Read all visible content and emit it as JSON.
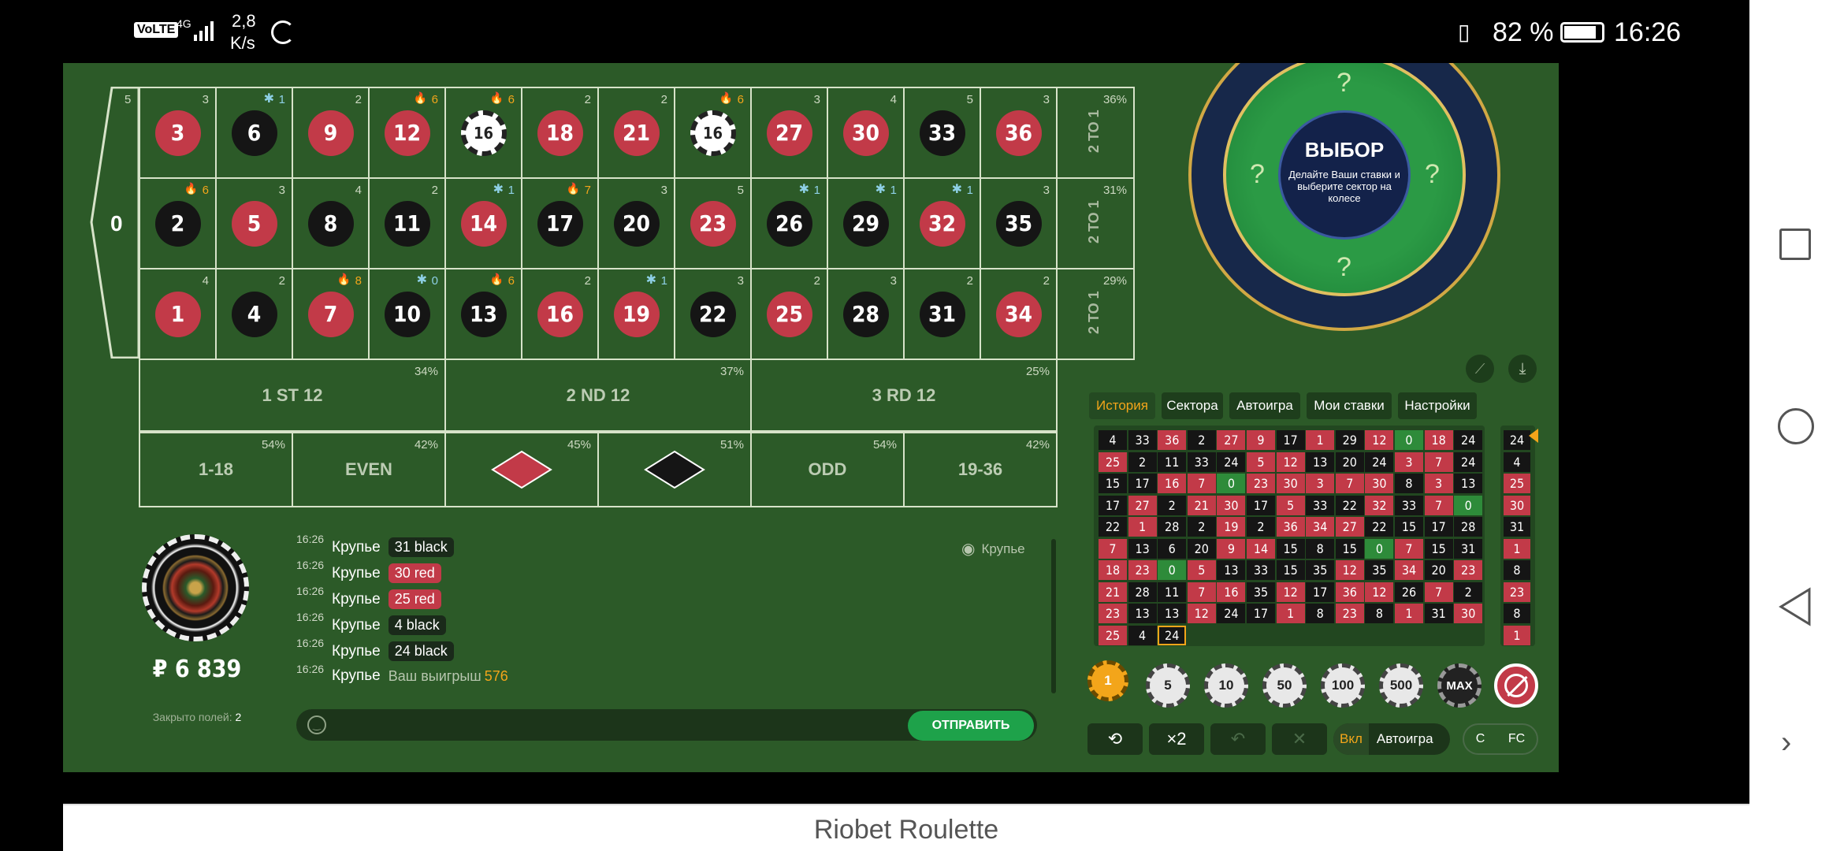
{
  "statusbar": {
    "network": "VoLTE",
    "signal": "4G",
    "speed_top": "2,8",
    "speed_bottom": "K/s",
    "battery": "82 %",
    "time": "16:26"
  },
  "app_title": "Riobet Roulette",
  "table": {
    "zero": "0",
    "zero_count": "5",
    "rows": [
      [
        {
          "n": "3",
          "c": "red",
          "cnt": "3"
        },
        {
          "n": "6",
          "c": "black",
          "cnt": "1",
          "mark": "cold"
        },
        {
          "n": "9",
          "c": "red",
          "cnt": "2"
        },
        {
          "n": "12",
          "c": "red",
          "cnt": "6",
          "mark": "hot"
        },
        {
          "n": "16",
          "c": "chip",
          "cnt": "6",
          "mark": "hot"
        },
        {
          "n": "18",
          "c": "red",
          "cnt": "2"
        },
        {
          "n": "21",
          "c": "red",
          "cnt": "2"
        },
        {
          "n": "16",
          "c": "chip",
          "cnt": "6",
          "mark": "hot"
        },
        {
          "n": "27",
          "c": "red",
          "cnt": "3"
        },
        {
          "n": "30",
          "c": "red",
          "cnt": "4"
        },
        {
          "n": "33",
          "c": "black",
          "cnt": "5"
        },
        {
          "n": "36",
          "c": "red",
          "cnt": "3"
        }
      ],
      [
        {
          "n": "2",
          "c": "black",
          "cnt": "6",
          "mark": "hot"
        },
        {
          "n": "5",
          "c": "red",
          "cnt": "3"
        },
        {
          "n": "8",
          "c": "black",
          "cnt": "4"
        },
        {
          "n": "11",
          "c": "black",
          "cnt": "2"
        },
        {
          "n": "14",
          "c": "red",
          "cnt": "1",
          "mark": "cold"
        },
        {
          "n": "17",
          "c": "black",
          "cnt": "7",
          "mark": "hot"
        },
        {
          "n": "20",
          "c": "black",
          "cnt": "3"
        },
        {
          "n": "23",
          "c": "red",
          "cnt": "5"
        },
        {
          "n": "26",
          "c": "black",
          "cnt": "1",
          "mark": "cold"
        },
        {
          "n": "29",
          "c": "black",
          "cnt": "1",
          "mark": "cold"
        },
        {
          "n": "32",
          "c": "red",
          "cnt": "1",
          "mark": "cold"
        },
        {
          "n": "35",
          "c": "black",
          "cnt": "3"
        }
      ],
      [
        {
          "n": "1",
          "c": "red",
          "cnt": "4"
        },
        {
          "n": "4",
          "c": "black",
          "cnt": "2"
        },
        {
          "n": "7",
          "c": "red",
          "cnt": "8",
          "mark": "hot"
        },
        {
          "n": "10",
          "c": "black",
          "cnt": "0",
          "mark": "cold"
        },
        {
          "n": "13",
          "c": "black",
          "cnt": "6",
          "mark": "hot"
        },
        {
          "n": "16",
          "c": "red",
          "cnt": "2"
        },
        {
          "n": "19",
          "c": "red",
          "cnt": "1",
          "mark": "cold"
        },
        {
          "n": "22",
          "c": "black",
          "cnt": "3"
        },
        {
          "n": "25",
          "c": "red",
          "cnt": "2"
        },
        {
          "n": "28",
          "c": "black",
          "cnt": "3"
        },
        {
          "n": "31",
          "c": "black",
          "cnt": "2"
        },
        {
          "n": "34",
          "c": "red",
          "cnt": "2"
        }
      ]
    ],
    "columns": [
      {
        "label": "2 TO 1",
        "pct": "36%"
      },
      {
        "label": "2 TO 1",
        "pct": "31%"
      },
      {
        "label": "2 TO 1",
        "pct": "29%"
      }
    ],
    "dozens": [
      {
        "label": "1 ST 12",
        "pct": "34%"
      },
      {
        "label": "2 ND 12",
        "pct": "37%"
      },
      {
        "label": "3 RD 12",
        "pct": "25%"
      }
    ],
    "outside": [
      {
        "label": "1-18",
        "pct": "54%"
      },
      {
        "label": "EVEN",
        "pct": "42%"
      },
      {
        "label": "",
        "pct": "45%"
      },
      {
        "label": "",
        "pct": "51%"
      },
      {
        "label": "ODD",
        "pct": "54%"
      },
      {
        "label": "19-36",
        "pct": "42%"
      }
    ]
  },
  "wheel": {
    "title": "ВЫБОР",
    "subtitle": "Делайте Ваши ставки и выберите сектор на колесе",
    "q": "?"
  },
  "balance": "₽ 6 839",
  "closed_fields": {
    "label": "Закрыто полей:",
    "value": "2"
  },
  "chat": {
    "dealer_label": "Крупье",
    "rows": [
      {
        "time": "16:26",
        "who": "Крупье",
        "text": "31 black",
        "kind": "b"
      },
      {
        "time": "16:26",
        "who": "Крупье",
        "text": "30 red",
        "kind": "r"
      },
      {
        "time": "16:26",
        "who": "Крупье",
        "text": "25 red",
        "kind": "r"
      },
      {
        "time": "16:26",
        "who": "Крупье",
        "text": "4 black",
        "kind": "b"
      },
      {
        "time": "16:26",
        "who": "Крупье",
        "text": "24 black",
        "kind": "b"
      }
    ],
    "win_time": "16:26",
    "win_who": "Крупье",
    "win_text": "Ваш выигрыш",
    "win_amount": "576",
    "send": "ОТПРАВИТЬ"
  },
  "tabs": [
    "История",
    "Сектора",
    "Автоигра",
    "Мои ставки",
    "Настройки"
  ],
  "history": [
    [
      "4",
      "33",
      "36",
      "2",
      "27",
      "9",
      "17",
      "1",
      "29",
      "12",
      "0",
      "18",
      "24"
    ],
    [
      "25",
      "2",
      "11",
      "33",
      "24",
      "5",
      "12",
      "13",
      "20",
      "24",
      "3",
      "7",
      "24"
    ],
    [
      "15",
      "17",
      "16",
      "7",
      "0",
      "23",
      "30",
      "3",
      "7",
      "30",
      "8",
      "3",
      "13"
    ],
    [
      "17",
      "27",
      "2",
      "21",
      "30",
      "17",
      "5",
      "33",
      "22",
      "32",
      "33",
      "7",
      "0"
    ],
    [
      "22",
      "1",
      "28",
      "2",
      "19",
      "2",
      "36",
      "34",
      "27",
      "22",
      "15",
      "17",
      "28"
    ],
    [
      "7",
      "13",
      "6",
      "20",
      "9",
      "14",
      "15",
      "8",
      "15",
      "0",
      "7",
      "15",
      "31"
    ],
    [
      "18",
      "23",
      "0",
      "5",
      "13",
      "33",
      "15",
      "35",
      "12",
      "35",
      "34",
      "20",
      "23"
    ],
    [
      "21",
      "28",
      "11",
      "7",
      "16",
      "35",
      "12",
      "17",
      "36",
      "12",
      "26",
      "7",
      "2"
    ],
    [
      "23",
      "13",
      "13",
      "12",
      "24",
      "17",
      "1",
      "8",
      "23",
      "8",
      "1",
      "31",
      "30"
    ],
    [
      "25",
      "4",
      "24"
    ]
  ],
  "last_numbers": [
    "24",
    "4",
    "25",
    "30",
    "31",
    "1",
    "8",
    "23",
    "8",
    "1"
  ],
  "chips": [
    "1",
    "5",
    "10",
    "50",
    "100",
    "500",
    "MAX"
  ],
  "controls": {
    "double": "×2",
    "on": "Вкл",
    "autoplay": "Автоигра",
    "c": "C",
    "fc": "FC"
  },
  "colors": {
    "felt": "#2c5a28",
    "red": "#c23a48",
    "black": "#151515",
    "green": "#2e8b3a",
    "accent": "#f3a51a",
    "send": "#1ea24a"
  }
}
